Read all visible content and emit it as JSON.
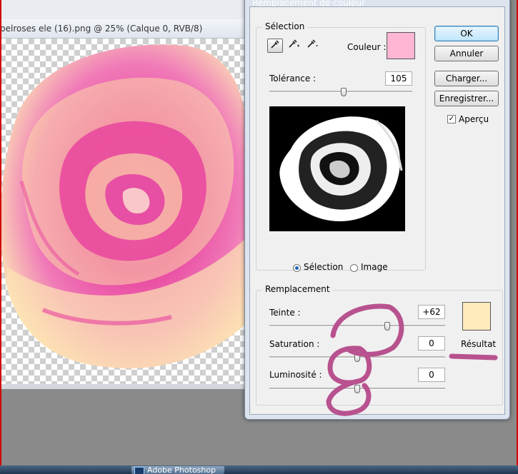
{
  "document": {
    "title": "pelroses ele (16).png @ 25% (Calque 0, RVB/8)"
  },
  "dialog": {
    "title": "Remplacement de couleur",
    "ok_label": "OK",
    "cancel_label": "Annuler",
    "load_label": "Charger...",
    "save_label": "Enregistrer...",
    "preview_label": "Aperçu",
    "preview_checked": true,
    "selection": {
      "legend": "Sélection",
      "color_label": "Couleur :",
      "color_value": "#ffb6d5",
      "tolerance_label": "Tolérance :",
      "tolerance_value": "105",
      "tolerance_level": 0.52,
      "view_selection_label": "Sélection",
      "view_image_label": "Image",
      "selected_view": "selection",
      "tools": [
        "eyedropper-icon",
        "eyedropper-plus-icon",
        "eyedropper-minus-icon"
      ]
    },
    "replacement": {
      "legend": "Remplacement",
      "hue_label": "Teinte :",
      "hue_value": "+62",
      "hue_level": 0.67,
      "saturation_label": "Saturation :",
      "saturation_value": "0",
      "saturation_level": 0.5,
      "lightness_label": "Luminosité :",
      "lightness_value": "0",
      "lightness_level": 0.5,
      "result_label": "Résultat",
      "result_color": "#ffeabb"
    }
  },
  "taskbar": {
    "task_label": "Adobe Photoshop"
  },
  "colors": {
    "annotation": "#b8528f",
    "rose_pink": "#e8449e",
    "rose_cream": "#fce4b4"
  }
}
